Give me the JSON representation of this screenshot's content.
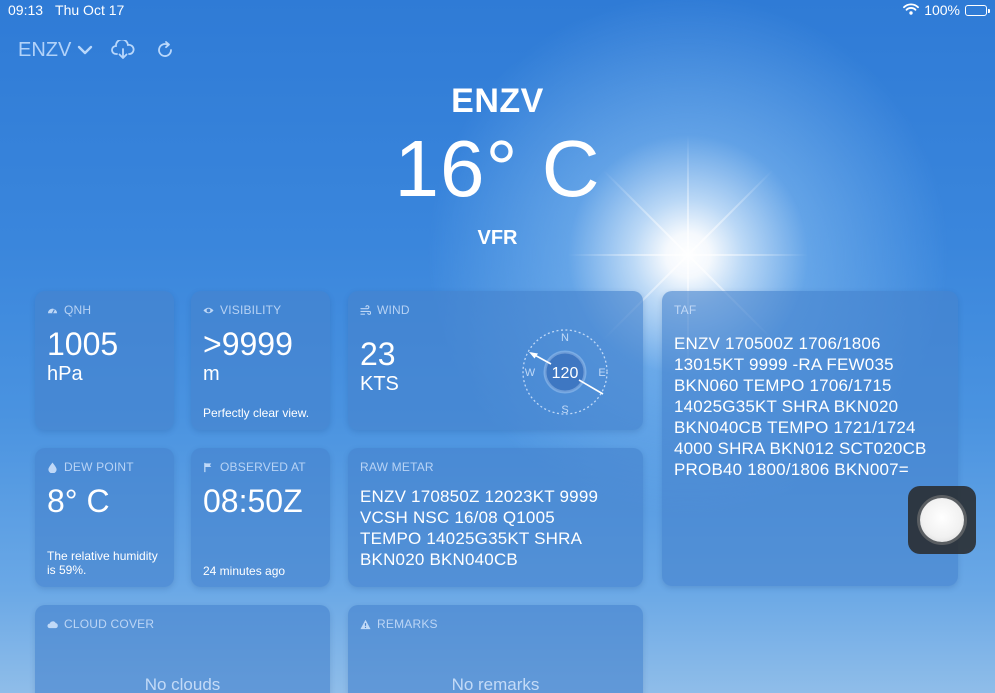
{
  "status_bar": {
    "time": "09:13",
    "date": "Thu Oct 17",
    "battery": "100%"
  },
  "toolbar": {
    "station": "ENZV"
  },
  "hero": {
    "station": "ENZV",
    "temperature": "16° C",
    "flight_rules": "VFR"
  },
  "qnh": {
    "title": "QNH",
    "value": "1005",
    "unit": "hPa"
  },
  "visibility": {
    "title": "VISIBILITY",
    "value": ">9999",
    "unit": "m",
    "note": "Perfectly clear view."
  },
  "wind": {
    "title": "WIND",
    "speed": "23",
    "unit": "KTS",
    "direction": "120",
    "compass": {
      "n": "N",
      "e": "E",
      "s": "S",
      "w": "W"
    }
  },
  "taf": {
    "title": "TAF",
    "lines": [
      "ENZV 170500Z 1706/1806",
      "13015KT 9999 -RA FEW035",
      "BKN060 TEMPO 1706/1715",
      "14025G35KT SHRA BKN020",
      "BKN040CB TEMPO 1721/1724",
      "4000 SHRA BKN012 SCT020CB",
      "PROB40 1800/1806 BKN007="
    ]
  },
  "dew_point": {
    "title": "DEW POINT",
    "value": "8° C",
    "note_line1": "The relative humidity",
    "note_line2": "is 59%."
  },
  "observed": {
    "title": "OBSERVED AT",
    "value": "08:50Z",
    "note": "24 minutes ago"
  },
  "raw_metar": {
    "title": "RAW METAR",
    "lines": [
      "ENZV 170850Z 12023KT 9999",
      "VCSH NSC 16/08 Q1005",
      "TEMPO 14025G35KT SHRA",
      "BKN020 BKN040CB"
    ]
  },
  "cloud_cover": {
    "title": "CLOUD COVER",
    "value": "No clouds"
  },
  "remarks": {
    "title": "REMARKS",
    "value": "No remarks"
  }
}
